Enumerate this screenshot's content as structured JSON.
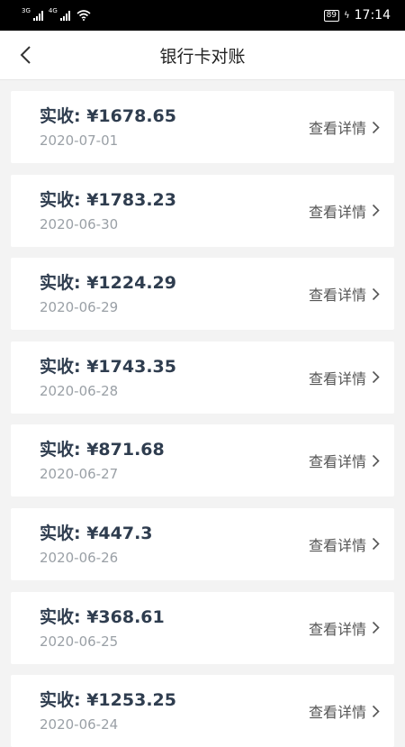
{
  "status_bar": {
    "network1": "3G",
    "network2": "4G",
    "battery": "89",
    "time": "17:14"
  },
  "header": {
    "title": "银行卡对账"
  },
  "records": [
    {
      "amount_label": "实收: ¥1678.65",
      "date": "2020-07-01",
      "link": "查看详情"
    },
    {
      "amount_label": "实收: ¥1783.23",
      "date": "2020-06-30",
      "link": "查看详情"
    },
    {
      "amount_label": "实收: ¥1224.29",
      "date": "2020-06-29",
      "link": "查看详情"
    },
    {
      "amount_label": "实收: ¥1743.35",
      "date": "2020-06-28",
      "link": "查看详情"
    },
    {
      "amount_label": "实收: ¥871.68",
      "date": "2020-06-27",
      "link": "查看详情"
    },
    {
      "amount_label": "实收: ¥447.3",
      "date": "2020-06-26",
      "link": "查看详情"
    },
    {
      "amount_label": "实收: ¥368.61",
      "date": "2020-06-25",
      "link": "查看详情"
    },
    {
      "amount_label": "实收: ¥1253.25",
      "date": "2020-06-24",
      "link": "查看详情"
    }
  ],
  "icons": {
    "back": "chevron-left-icon",
    "detail": "chevron-right-icon",
    "wifi": "wifi-icon"
  },
  "colors": {
    "amount": "#2f3d4f",
    "date": "#9aa0a6",
    "background": "#f3f3f3"
  }
}
